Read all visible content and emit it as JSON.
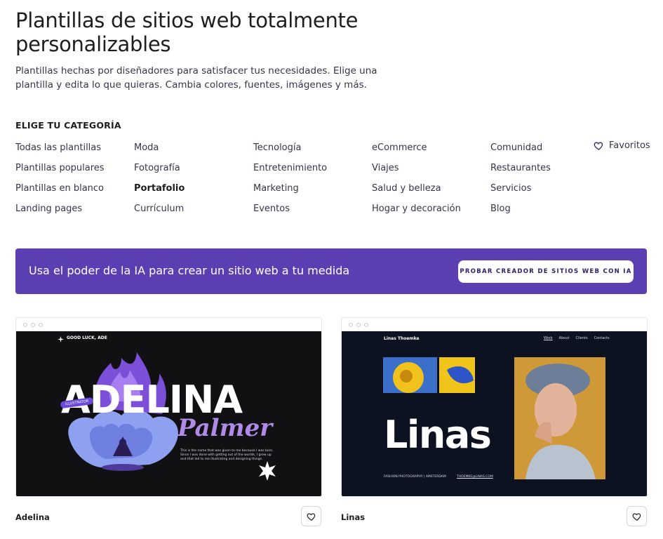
{
  "header": {
    "title": "Plantillas de sitios web totalmente personalizables",
    "subtitle": "Plantillas hechas por diseñadores para satisfacer tus necesidades. Elige una plantilla y edita lo que quieras. Cambia colores, fuentes, imágenes y más."
  },
  "categories": {
    "heading": "ELIGE TU CATEGORÍA",
    "columns": [
      [
        "Todas las plantillas",
        "Plantillas populares",
        "Plantillas en blanco",
        "Landing pages"
      ],
      [
        "Moda",
        "Fotografía",
        "Portafolio",
        "Currículum"
      ],
      [
        "Tecnología",
        "Entretenimiento",
        "Marketing",
        "Eventos"
      ],
      [
        "eCommerce",
        "Viajes",
        "Salud y belleza",
        "Hogar y decoración"
      ],
      [
        "Comunidad",
        "Restaurantes",
        "Servicios",
        "Blog"
      ]
    ],
    "active": "Portafolio",
    "favorites_label": "Favoritos",
    "favorites_icon": "heart-icon"
  },
  "ai_banner": {
    "text": "Usa el poder de la IA para crear un sitio web a tu medida",
    "button_label": "PROBAR CREADOR DE SITIOS WEB CON IA",
    "background": "#5b3fb2"
  },
  "templates": [
    {
      "name": "Adelina",
      "preview": {
        "logo": "GOOD LUCK, ADE",
        "headline": "ADELINA",
        "script": "Palmer",
        "tag": "ILLUSTRATOR",
        "body": "This is the name that was given to me because I was born. Since I was done with getting out of the worlds, I grew up and that led to me illustrating and designing things."
      }
    },
    {
      "name": "Linas",
      "preview": {
        "brand": "Linas Thoemke",
        "nav": [
          "Work",
          "About",
          "Clients",
          "Contacts"
        ],
        "headline": "Linas",
        "footer": "FASHION PHOTOGRAPHY | AMSTERDAM",
        "email": "THOEMKE@LINAS.COM"
      }
    }
  ]
}
